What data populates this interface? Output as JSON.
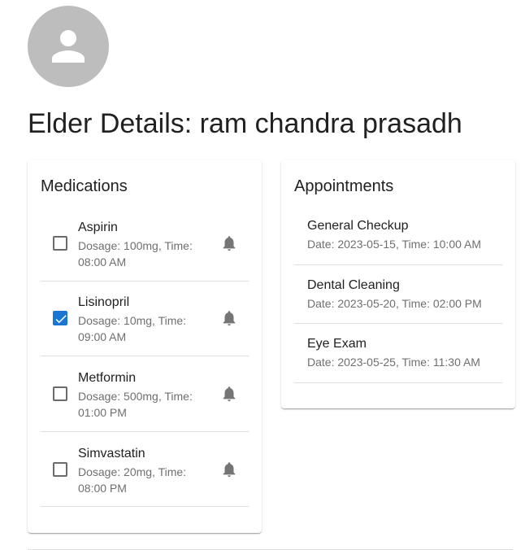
{
  "profile": {
    "avatar_icon": "person-icon",
    "avatar_color": "#bdbdbd",
    "title": "Elder Details: ram chandra prasadh"
  },
  "medications": {
    "heading": "Medications",
    "items": [
      {
        "name": "Aspirin",
        "detail": "Dosage: 100mg, Time: 08:00 AM",
        "checked": false,
        "icon": "bell-icon"
      },
      {
        "name": "Lisinopril",
        "detail": "Dosage: 10mg, Time: 09:00 AM",
        "checked": true,
        "icon": "bell-icon"
      },
      {
        "name": "Metformin",
        "detail": "Dosage: 500mg, Time: 01:00 PM",
        "checked": false,
        "icon": "bell-icon"
      },
      {
        "name": "Simvastatin",
        "detail": "Dosage: 20mg, Time: 08:00 PM",
        "checked": false,
        "icon": "bell-icon"
      }
    ]
  },
  "appointments": {
    "heading": "Appointments",
    "items": [
      {
        "name": "General Checkup",
        "detail": "Date: 2023-05-15, Time: 10:00 AM"
      },
      {
        "name": "Dental Cleaning",
        "detail": "Date: 2023-05-20, Time: 02:00 PM"
      },
      {
        "name": "Eye Exam",
        "detail": "Date: 2023-05-25, Time: 11:30 AM"
      }
    ]
  },
  "colors": {
    "accent": "#1976d2",
    "text_primary": "#212121",
    "text_secondary": "#6f6f6f",
    "divider": "#e0e0e0"
  }
}
